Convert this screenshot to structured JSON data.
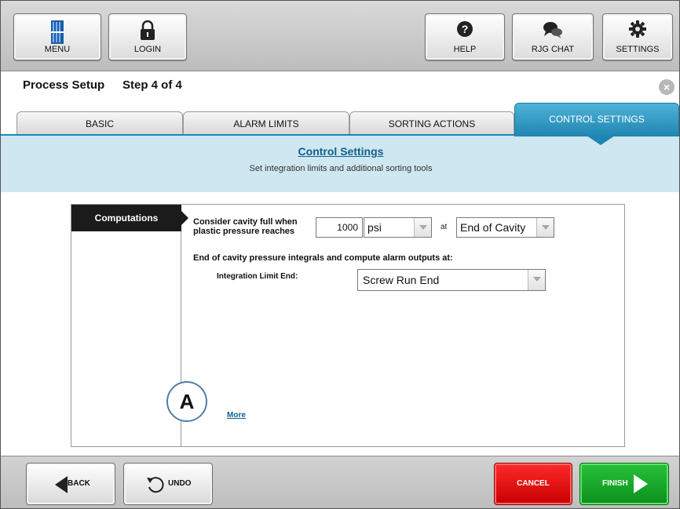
{
  "toolbar": {
    "menu_label": "MENU",
    "login_label": "LOGIN",
    "help_label": "HELP",
    "chat_label": "RJG CHAT",
    "settings_label": "SETTINGS"
  },
  "header": {
    "title": "Process Setup",
    "step": "Step 4 of 4",
    "close_glyph": "×"
  },
  "tabs": [
    {
      "label": "BASIC",
      "active": false
    },
    {
      "label": "ALARM LIMITS",
      "active": false
    },
    {
      "label": "SORTING ACTIONS",
      "active": false
    },
    {
      "label": "CONTROL SETTINGS",
      "active": true
    }
  ],
  "band": {
    "title": "Control Settings",
    "subtitle": "Set integration limits and additional sorting tools"
  },
  "sidebar": {
    "items": [
      {
        "label": "Computations",
        "selected": true
      }
    ]
  },
  "form": {
    "cavity_full_label_line1": "Consider cavity full when",
    "cavity_full_label_line2": "plastic pressure reaches",
    "pressure_value": "1000",
    "unit_selected": "psi",
    "at_label": "at",
    "location_selected": "End of Cavity",
    "integrals_label": "End of cavity pressure integrals and compute alarm outputs at:",
    "integration_limit_label": "Integration Limit End:",
    "integration_limit_selected": "Screw Run End",
    "more_link": "More"
  },
  "callout": {
    "label": "A"
  },
  "bottom": {
    "back_label": "BACK",
    "undo_label": "UNDO",
    "cancel_label": "CANCEL",
    "finish_label": "FINISH"
  },
  "colors": {
    "accent_blue": "#1f86b3",
    "band_bg": "#cfe7f0",
    "cancel_red": "#e00000",
    "finish_green": "#1aa82c"
  },
  "icons": [
    "menu-icon",
    "lock-icon",
    "help-icon",
    "chat-icon",
    "gear-icon",
    "close-icon",
    "back-arrow-icon",
    "undo-icon",
    "finish-arrow-icon",
    "dropdown-arrow-icon"
  ]
}
